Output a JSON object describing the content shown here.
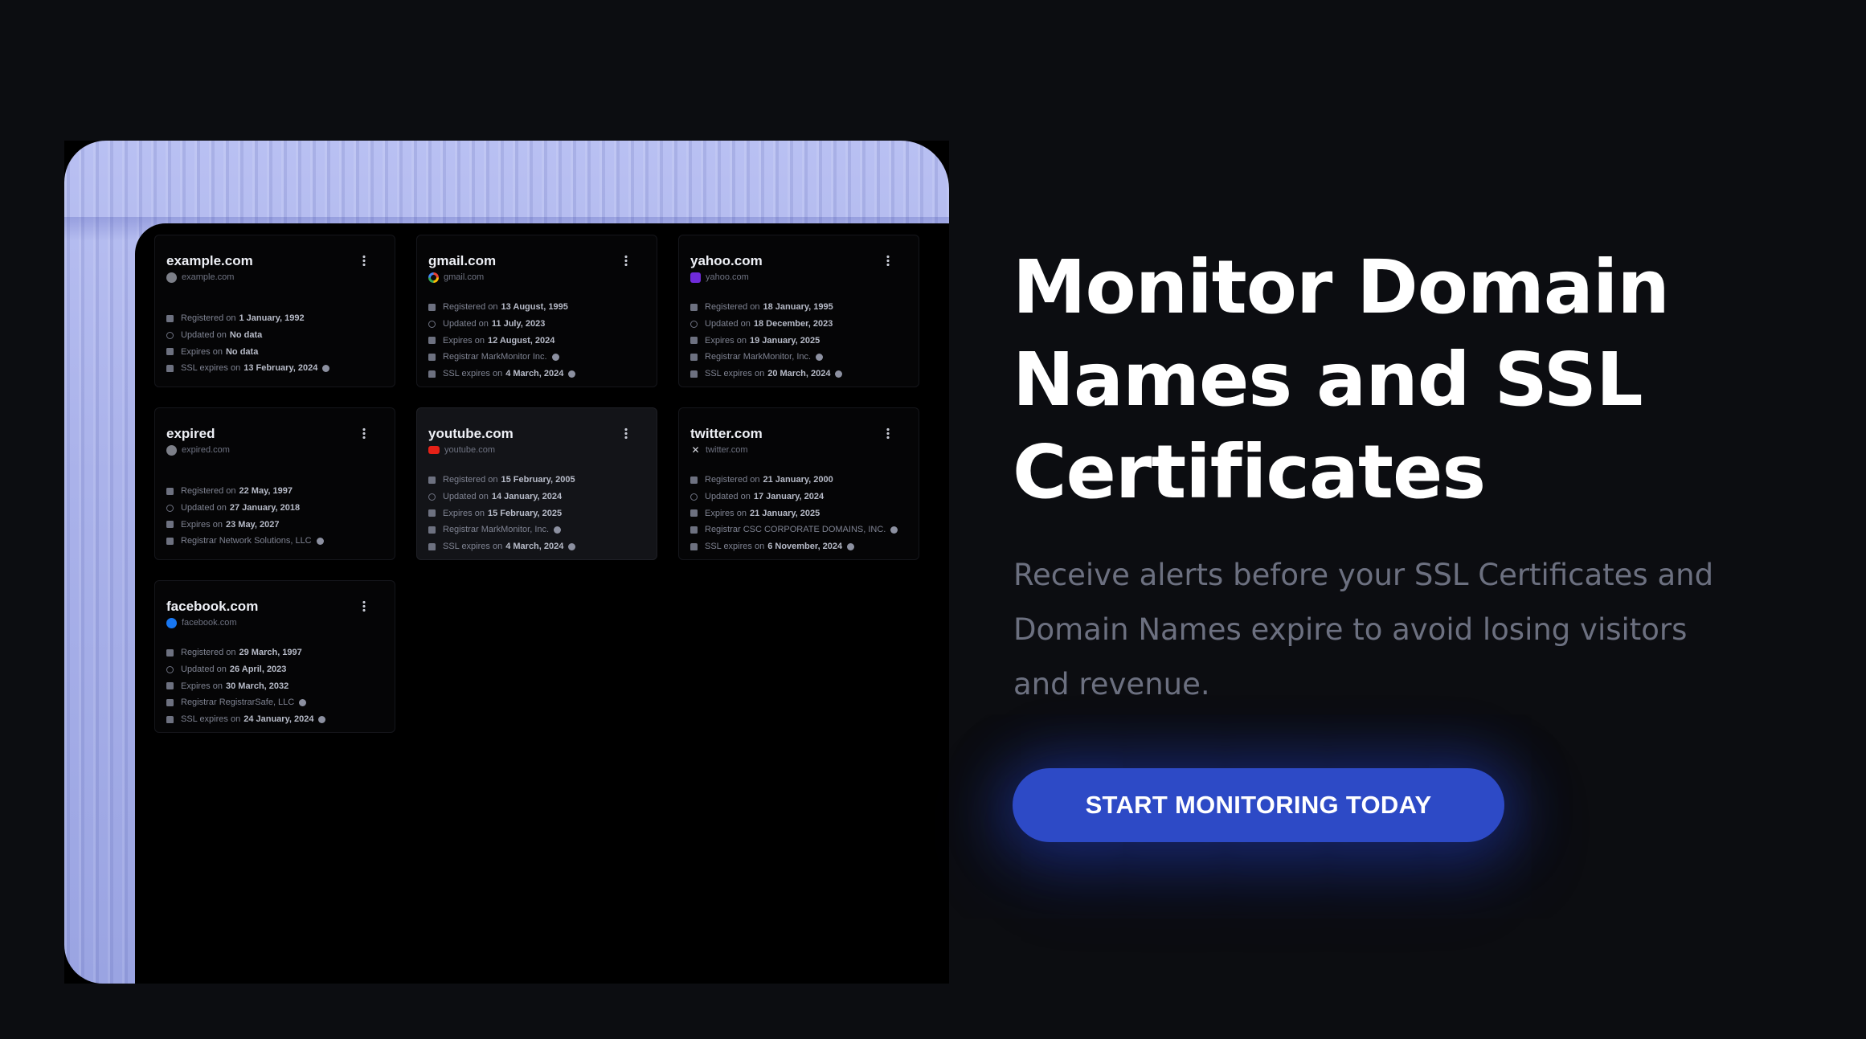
{
  "hero": {
    "title_line1": "Monitor Domain",
    "title_line2": "Names and SSL",
    "title_line3": "Certificates",
    "subtitle": "Receive alerts before your SSL Certificates and Domain Names expire to avoid losing visitors and revenue.",
    "cta_label": "START MONITORING TODAY"
  },
  "domains": [
    {
      "name": "example.com",
      "domain": "example.com",
      "icon": "globe-icon",
      "rows": [
        {
          "label": "Registered on",
          "value": "1 January, 1992"
        },
        {
          "label": "Updated on",
          "value": "No data"
        },
        {
          "label": "Expires on",
          "value": "No data"
        },
        {
          "label": "SSL expires on",
          "value": "13 February, 2024"
        }
      ]
    },
    {
      "name": "gmail.com",
      "domain": "gmail.com",
      "icon": "google-icon",
      "rows": [
        {
          "label": "Registered on",
          "value": "13 August, 1995"
        },
        {
          "label": "Updated on",
          "value": "11 July, 2023"
        },
        {
          "label": "Expires on",
          "value": "12 August, 2024"
        },
        {
          "label": "Registrar",
          "value": "MarkMonitor Inc."
        },
        {
          "label": "SSL expires on",
          "value": "4 March, 2024"
        }
      ]
    },
    {
      "name": "yahoo.com",
      "domain": "yahoo.com",
      "icon": "yahoo-icon",
      "rows": [
        {
          "label": "Registered on",
          "value": "18 January, 1995"
        },
        {
          "label": "Updated on",
          "value": "18 December, 2023"
        },
        {
          "label": "Expires on",
          "value": "19 January, 2025"
        },
        {
          "label": "Registrar",
          "value": "MarkMonitor, Inc."
        },
        {
          "label": "SSL expires on",
          "value": "20 March, 2024"
        }
      ]
    },
    {
      "name": "expired",
      "domain": "expired.com",
      "icon": "globe-icon",
      "rows": [
        {
          "label": "Registered on",
          "value": "22 May, 1997"
        },
        {
          "label": "Updated on",
          "value": "27 January, 2018"
        },
        {
          "label": "Expires on",
          "value": "23 May, 2027"
        },
        {
          "label": "Registrar",
          "value": "Network Solutions, LLC"
        }
      ]
    },
    {
      "name": "youtube.com",
      "domain": "youtube.com",
      "icon": "youtube-icon",
      "rows": [
        {
          "label": "Registered on",
          "value": "15 February, 2005"
        },
        {
          "label": "Updated on",
          "value": "14 January, 2024"
        },
        {
          "label": "Expires on",
          "value": "15 February, 2025"
        },
        {
          "label": "Registrar",
          "value": "MarkMonitor, Inc."
        },
        {
          "label": "SSL expires on",
          "value": "4 March, 2024"
        }
      ]
    },
    {
      "name": "twitter.com",
      "domain": "twitter.com",
      "icon": "x-icon",
      "rows": [
        {
          "label": "Registered on",
          "value": "21 January, 2000"
        },
        {
          "label": "Updated on",
          "value": "17 January, 2024"
        },
        {
          "label": "Expires on",
          "value": "21 January, 2025"
        },
        {
          "label": "Registrar",
          "value": "CSC CORPORATE DOMAINS, INC."
        },
        {
          "label": "SSL expires on",
          "value": "6 November, 2024"
        }
      ]
    },
    {
      "name": "facebook.com",
      "domain": "facebook.com",
      "icon": "facebook-icon",
      "rows": [
        {
          "label": "Registered on",
          "value": "29 March, 1997"
        },
        {
          "label": "Updated on",
          "value": "26 April, 2023"
        },
        {
          "label": "Expires on",
          "value": "30 March, 2032"
        },
        {
          "label": "Registrar",
          "value": "RegistrarSafe, LLC"
        },
        {
          "label": "SSL expires on",
          "value": "24 January, 2024"
        }
      ]
    }
  ],
  "colors": {
    "background": "#0c0d11",
    "accent": "#2d4ac6",
    "frame": "#aab2ea"
  }
}
